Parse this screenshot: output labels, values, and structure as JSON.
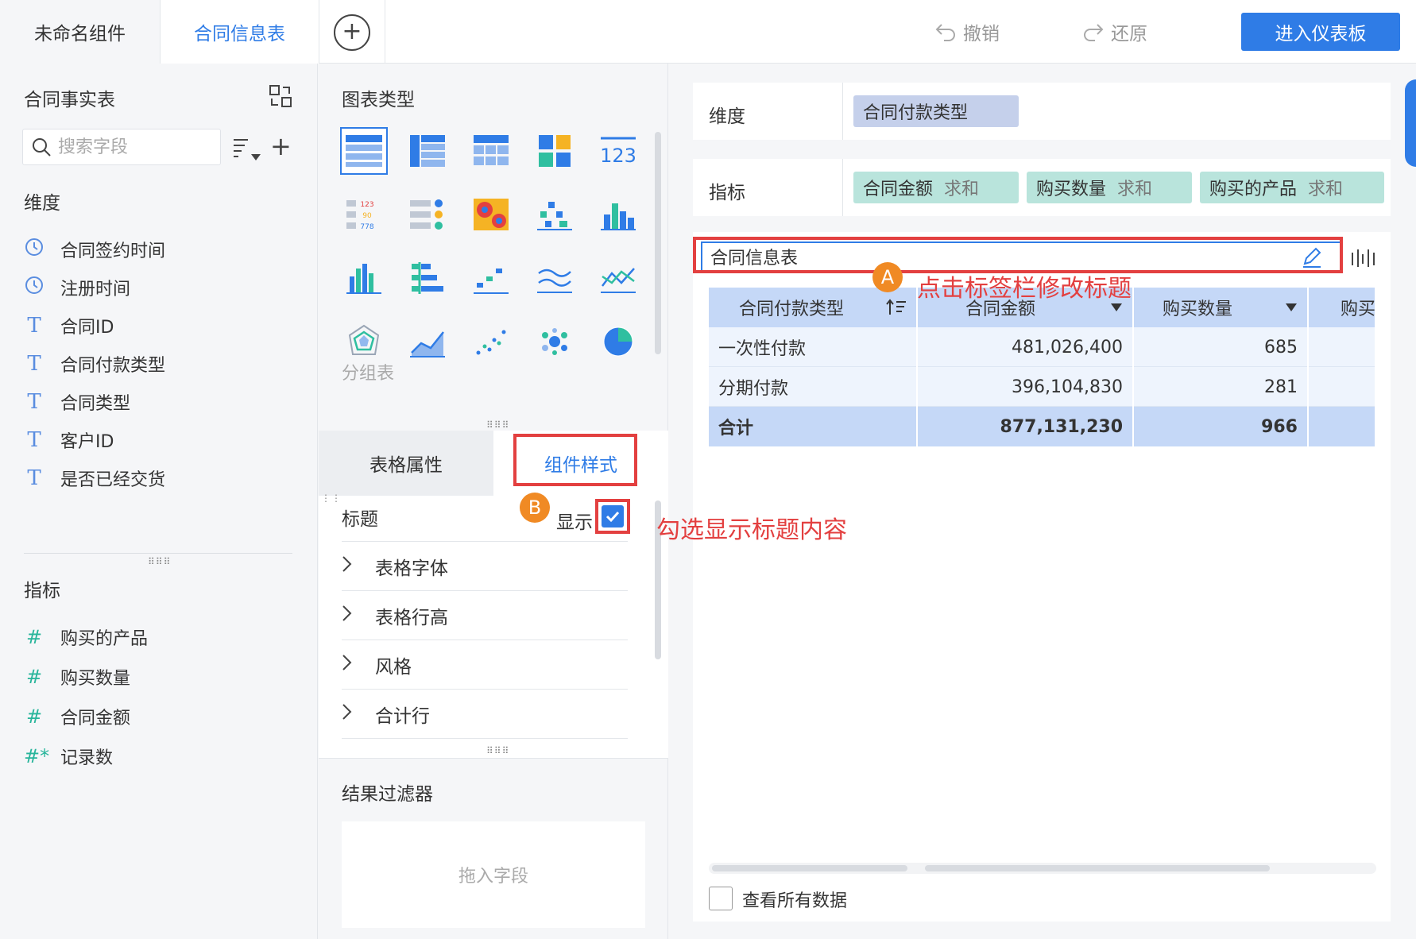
{
  "tabs": {
    "tab1": "未命名组件",
    "tab2": "合同信息表",
    "add": "+"
  },
  "toolbar": {
    "undo": "撤销",
    "redo": "还原",
    "enter": "进入仪表板"
  },
  "left": {
    "title": "合同事实表",
    "search_placeholder": "搜索字段",
    "dim_label": "维度",
    "dims": [
      {
        "icon": "clock",
        "label": "合同签约时间"
      },
      {
        "icon": "clock",
        "label": "注册时间"
      },
      {
        "icon": "text",
        "label": "合同ID"
      },
      {
        "icon": "text",
        "label": "合同付款类型"
      },
      {
        "icon": "text",
        "label": "合同类型"
      },
      {
        "icon": "text",
        "label": "客户ID"
      },
      {
        "icon": "text",
        "label": "是否已经交货"
      }
    ],
    "mea_label": "指标",
    "measures": [
      {
        "icon": "#",
        "label": "购买的产品"
      },
      {
        "icon": "#",
        "label": "购买数量"
      },
      {
        "icon": "#",
        "label": "合同金额"
      },
      {
        "icon": "#*",
        "label": "记录数"
      }
    ]
  },
  "middle": {
    "chart_type_title": "图表类型",
    "group_label": "分组表",
    "tab_table_props": "表格属性",
    "tab_widget_style": "组件样式",
    "title_row": "标题",
    "show_label": "显示",
    "rows": [
      "表格字体",
      "表格行高",
      "风格",
      "合计行"
    ],
    "filter_title": "结果过滤器",
    "drop_hint": "拖入字段"
  },
  "right": {
    "dim_bar_label": "维度",
    "dim_pill": "合同付款类型",
    "mea_bar_label": "指标",
    "mea_pills": [
      {
        "name": "合同金额",
        "agg": "求和"
      },
      {
        "name": "购买数量",
        "agg": "求和"
      },
      {
        "name": "购买的产品",
        "agg": "求和"
      }
    ],
    "widget_title": "合同信息表",
    "table": {
      "headers": [
        "合同付款类型",
        "合同金额",
        "购买数量",
        "购买"
      ],
      "rows": [
        [
          "一次性付款",
          "481,026,400",
          "685"
        ],
        [
          "分期付款",
          "396,104,830",
          "281"
        ]
      ],
      "total": [
        "合计",
        "877,131,230",
        "966"
      ]
    },
    "view_all": "查看所有数据"
  },
  "annotations": {
    "a_badge": "A",
    "a_text": "点击标签栏修改标题",
    "b_badge": "B",
    "b_text": "勾选显示标题内容"
  },
  "colors": {
    "accent": "#2f7ce6",
    "annotation": "#e34040",
    "badge": "#f08a24"
  }
}
